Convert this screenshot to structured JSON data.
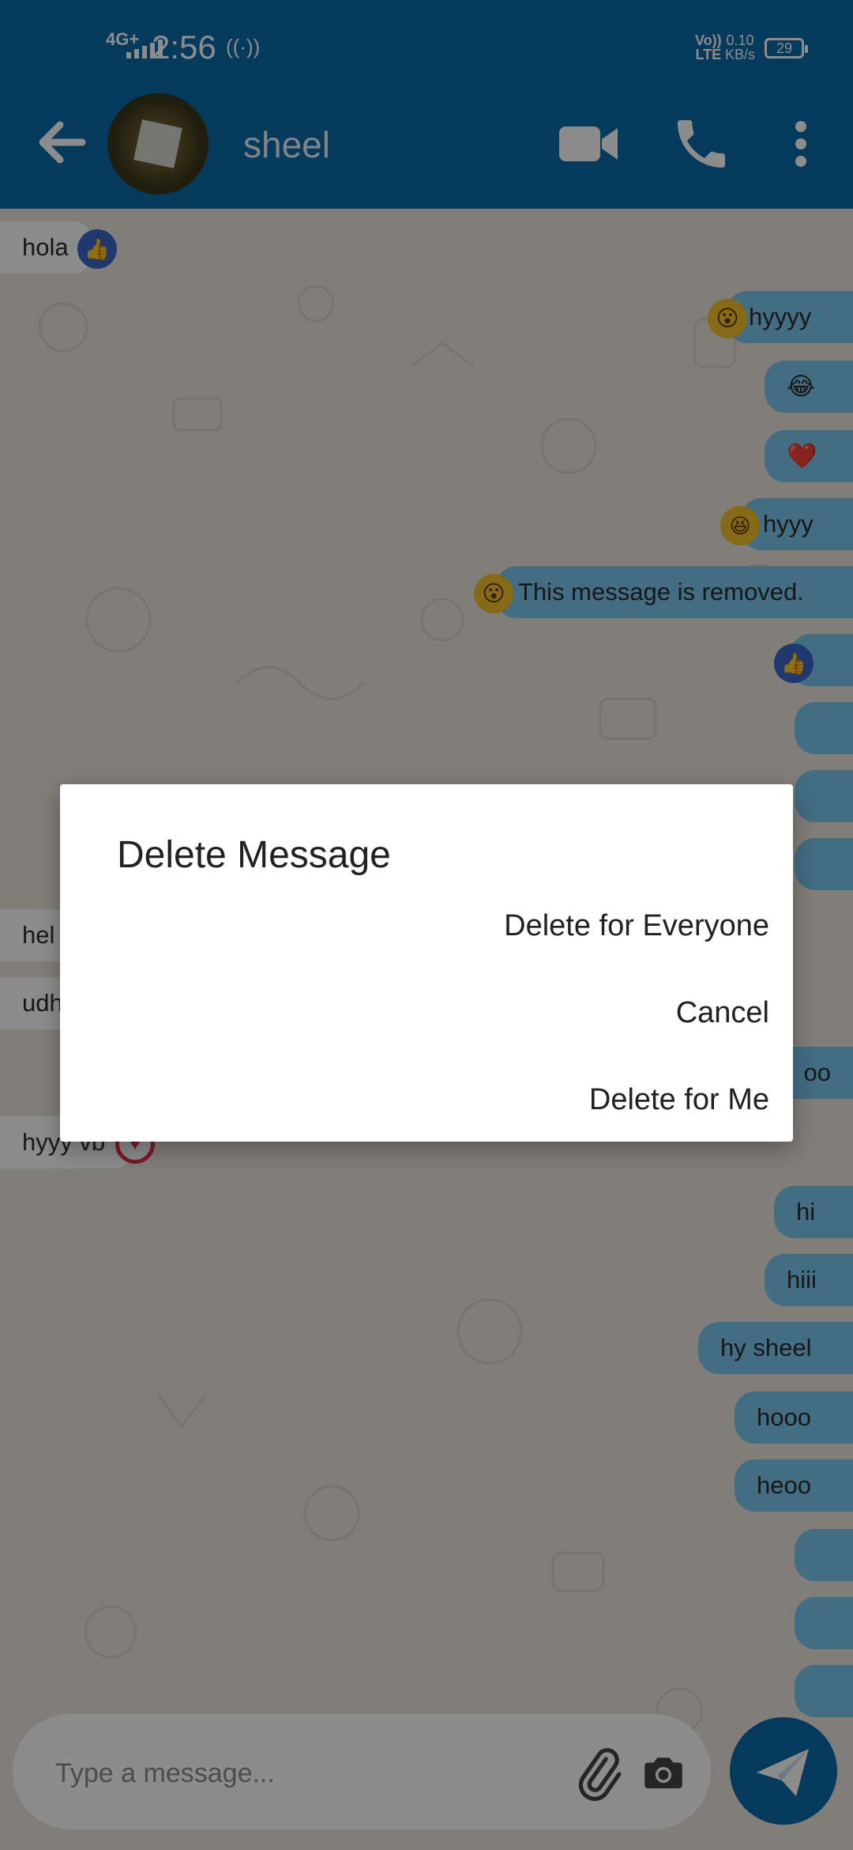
{
  "status_bar": {
    "network": "4G+",
    "time": "2:56",
    "volte": "Vo))\nLTE",
    "speed": "0.10\nKB/s",
    "battery": "29"
  },
  "header": {
    "contact_name": "sheel",
    "icons": [
      "back-arrow-icon",
      "video-call-icon",
      "phone-icon",
      "more-vert-icon"
    ]
  },
  "messages": [
    {
      "dir": "in",
      "text": "hola",
      "reaction": "like"
    },
    {
      "dir": "out",
      "text": "hyyyy",
      "reaction": "wow"
    },
    {
      "dir": "out",
      "text": "😂",
      "reaction": ""
    },
    {
      "dir": "out",
      "text": "❤️",
      "reaction": ""
    },
    {
      "dir": "out",
      "text": "hyyy",
      "reaction": "laugh"
    },
    {
      "dir": "out",
      "text": "This message is removed.",
      "reaction": "wow"
    },
    {
      "dir": "out",
      "text": "",
      "reaction": "like"
    },
    {
      "dir": "out",
      "text": "",
      "reaction": ""
    },
    {
      "dir": "out",
      "text": "",
      "reaction": ""
    },
    {
      "dir": "out",
      "text": "",
      "reaction": ""
    },
    {
      "dir": "in",
      "text": "hel",
      "reaction": ""
    },
    {
      "dir": "in",
      "text": "udh",
      "reaction": ""
    },
    {
      "dir": "out",
      "text": "oo",
      "reaction": ""
    },
    {
      "dir": "in",
      "text": "hyyy vb",
      "reaction": "heart"
    },
    {
      "dir": "out",
      "text": "hi",
      "reaction": ""
    },
    {
      "dir": "out",
      "text": "hiii",
      "reaction": ""
    },
    {
      "dir": "out",
      "text": "hy sheel",
      "reaction": ""
    },
    {
      "dir": "out",
      "text": "hooo",
      "reaction": ""
    },
    {
      "dir": "out",
      "text": "heoo",
      "reaction": ""
    },
    {
      "dir": "out",
      "text": "",
      "reaction": ""
    },
    {
      "dir": "out",
      "text": "",
      "reaction": ""
    },
    {
      "dir": "out",
      "text": "",
      "reaction": ""
    }
  ],
  "composer": {
    "placeholder": "Type a message..."
  },
  "dialog": {
    "title": "Delete Message",
    "delete_for_everyone": "Delete for Everyone",
    "cancel": "Cancel",
    "delete_for_me": "Delete for Me"
  },
  "colors": {
    "app_bar": "#0b6aa8",
    "outgoing_bubble": "#7bc6ee",
    "incoming_bubble": "#ffffff",
    "chat_background": "#ece5dd",
    "send_button": "#0b6aa8"
  }
}
